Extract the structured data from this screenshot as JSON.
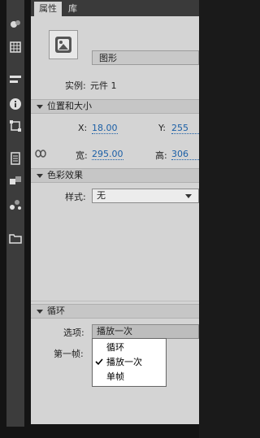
{
  "tabs": [
    {
      "label": "属性",
      "active": true
    },
    {
      "label": "库",
      "active": false
    }
  ],
  "symbol": {
    "type_value": "图形",
    "instance_label": "实例:",
    "instance_value": "元件 1"
  },
  "position_size": {
    "title": "位置和大小",
    "x_label": "X:",
    "x_value": "18.00",
    "y_label": "Y:",
    "y_value": "255",
    "w_label": "宽:",
    "w_value": "295.00",
    "h_label": "高:",
    "h_value": "306"
  },
  "color_effect": {
    "title": "色彩效果",
    "style_label": "样式:",
    "style_value": "无"
  },
  "loop": {
    "title": "循环",
    "options_label": "选项:",
    "options_value": "播放一次",
    "first_frame_label": "第一帧:",
    "dropdown_items": [
      {
        "label": "循环",
        "checked": false
      },
      {
        "label": "播放一次",
        "checked": true
      },
      {
        "label": "单帧",
        "checked": false
      }
    ]
  },
  "colors": {
    "panel_bg": "#d4d4d4",
    "value_blue": "#1b5fa6",
    "toolstrip_bg": "#3c3c3c"
  }
}
